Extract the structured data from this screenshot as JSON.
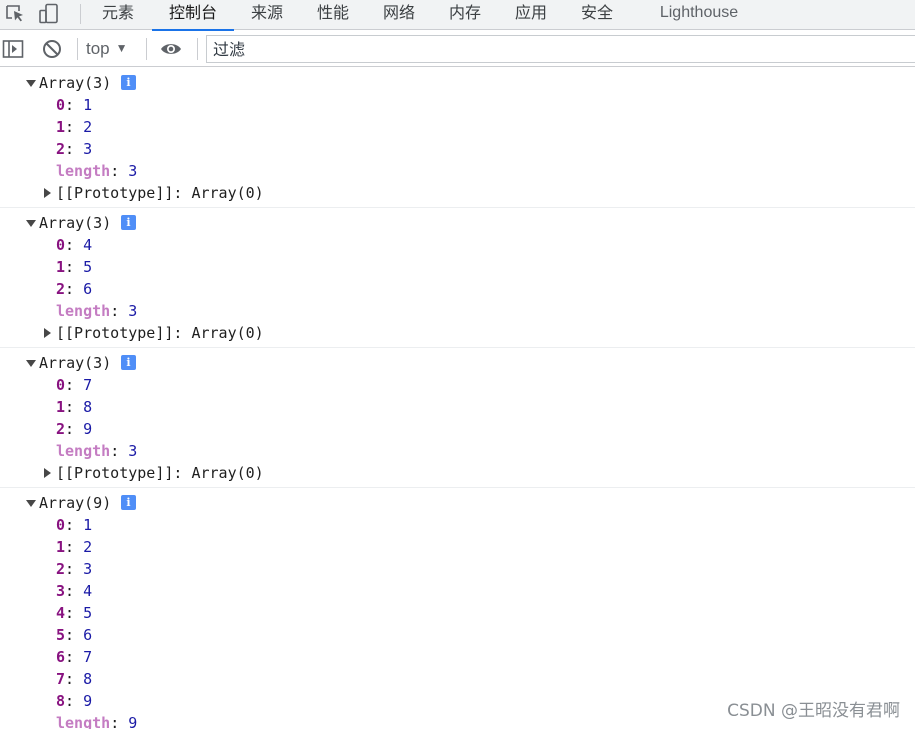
{
  "tabbar": {
    "icons": [
      "inspect-element-icon",
      "device-toolbar-icon"
    ],
    "tabs": [
      {
        "label": "元素",
        "active": false
      },
      {
        "label": "控制台",
        "active": true
      },
      {
        "label": "来源",
        "active": false
      },
      {
        "label": "性能",
        "active": false
      },
      {
        "label": "网络",
        "active": false
      },
      {
        "label": "内存",
        "active": false
      },
      {
        "label": "应用",
        "active": false
      },
      {
        "label": "安全",
        "active": false
      },
      {
        "label": "Lighthouse",
        "active": false
      }
    ]
  },
  "toolbar": {
    "icons": [
      "show-sidebar-icon",
      "clear-console-icon",
      "live-expression-eye-icon"
    ],
    "context": "top",
    "filter_placeholder": "过滤"
  },
  "messages": [
    {
      "header": "Array(3)",
      "items": [
        {
          "key": "0",
          "value": "1"
        },
        {
          "key": "1",
          "value": "2"
        },
        {
          "key": "2",
          "value": "3"
        }
      ],
      "length": "3",
      "proto": "[[Prototype]]: Array(0)"
    },
    {
      "header": "Array(3)",
      "items": [
        {
          "key": "0",
          "value": "4"
        },
        {
          "key": "1",
          "value": "5"
        },
        {
          "key": "2",
          "value": "6"
        }
      ],
      "length": "3",
      "proto": "[[Prototype]]: Array(0)"
    },
    {
      "header": "Array(3)",
      "items": [
        {
          "key": "0",
          "value": "7"
        },
        {
          "key": "1",
          "value": "8"
        },
        {
          "key": "2",
          "value": "9"
        }
      ],
      "length": "3",
      "proto": "[[Prototype]]: Array(0)"
    },
    {
      "header": "Array(9)",
      "items": [
        {
          "key": "0",
          "value": "1"
        },
        {
          "key": "1",
          "value": "2"
        },
        {
          "key": "2",
          "value": "3"
        },
        {
          "key": "3",
          "value": "4"
        },
        {
          "key": "4",
          "value": "5"
        },
        {
          "key": "5",
          "value": "6"
        },
        {
          "key": "6",
          "value": "7"
        },
        {
          "key": "7",
          "value": "8"
        },
        {
          "key": "8",
          "value": "9"
        }
      ],
      "length": "9",
      "proto": ""
    }
  ],
  "labels": {
    "length_key": "length",
    "colon": ": ",
    "info_glyph": "i"
  },
  "watermark": "CSDN @王昭没有君啊",
  "colors": {
    "accent": "#1a73e8",
    "info_badge": "#4f8ef7",
    "key": "#881280",
    "number": "#1a1aa6"
  }
}
